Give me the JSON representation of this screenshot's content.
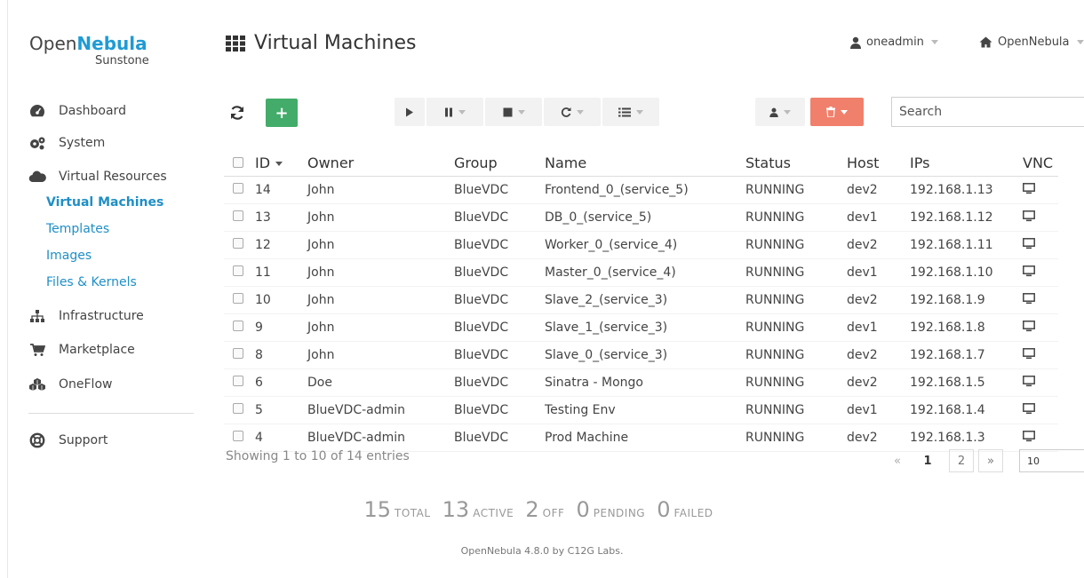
{
  "logo": {
    "prefix": "Open",
    "brand": "Nebula",
    "sub": "Sunstone"
  },
  "sidebar": {
    "items": [
      {
        "label": "Dashboard",
        "icon": "dashboard-icon"
      },
      {
        "label": "System",
        "icon": "cogs-icon"
      },
      {
        "label": "Virtual Resources",
        "icon": "cloud-icon"
      },
      {
        "label": "Infrastructure",
        "icon": "sitemap-icon"
      },
      {
        "label": "Marketplace",
        "icon": "cart-icon"
      },
      {
        "label": "OneFlow",
        "icon": "cubes-icon"
      },
      {
        "label": "Support",
        "icon": "lifebuoy-icon"
      }
    ],
    "subitems": [
      {
        "label": "Virtual Machines",
        "active": true
      },
      {
        "label": "Templates"
      },
      {
        "label": "Images"
      },
      {
        "label": "Files & Kernels"
      }
    ]
  },
  "header": {
    "title": "Virtual Machines",
    "user": "oneadmin",
    "zone": "OpenNebula"
  },
  "toolbar": {
    "add_label": "+",
    "search_placeholder": "Search"
  },
  "table": {
    "columns": [
      "ID",
      "Owner",
      "Group",
      "Name",
      "Status",
      "Host",
      "IPs",
      "VNC"
    ],
    "rows": [
      [
        "14",
        "John",
        "BlueVDC",
        "Frontend_0_(service_5)",
        "RUNNING",
        "dev2",
        "192.168.1.13"
      ],
      [
        "13",
        "John",
        "BlueVDC",
        "DB_0_(service_5)",
        "RUNNING",
        "dev1",
        "192.168.1.12"
      ],
      [
        "12",
        "John",
        "BlueVDC",
        "Worker_0_(service_4)",
        "RUNNING",
        "dev2",
        "192.168.1.11"
      ],
      [
        "11",
        "John",
        "BlueVDC",
        "Master_0_(service_4)",
        "RUNNING",
        "dev1",
        "192.168.1.10"
      ],
      [
        "10",
        "John",
        "BlueVDC",
        "Slave_2_(service_3)",
        "RUNNING",
        "dev2",
        "192.168.1.9"
      ],
      [
        "9",
        "John",
        "BlueVDC",
        "Slave_1_(service_3)",
        "RUNNING",
        "dev1",
        "192.168.1.8"
      ],
      [
        "8",
        "John",
        "BlueVDC",
        "Slave_0_(service_3)",
        "RUNNING",
        "dev2",
        "192.168.1.7"
      ],
      [
        "6",
        "Doe",
        "BlueVDC",
        "Sinatra - Mongo",
        "RUNNING",
        "dev2",
        "192.168.1.5"
      ],
      [
        "5",
        "BlueVDC-admin",
        "BlueVDC",
        "Testing Env",
        "RUNNING",
        "dev1",
        "192.168.1.4"
      ],
      [
        "4",
        "BlueVDC-admin",
        "BlueVDC",
        "Prod Machine",
        "RUNNING",
        "dev2",
        "192.168.1.3"
      ]
    ]
  },
  "pagination": {
    "showing": "Showing 1 to 10 of 14 entries",
    "prev": "«",
    "pages": [
      "1",
      "2"
    ],
    "next": "»",
    "page_size": "10"
  },
  "summary": {
    "total": "15",
    "total_label": "TOTAL",
    "active": "13",
    "active_label": "ACTIVE",
    "off": "2",
    "off_label": "OFF",
    "pending": "0",
    "pending_label": "PENDING",
    "failed": "0",
    "failed_label": "FAILED"
  },
  "footer": "OpenNebula 4.8.0 by C12G Labs.",
  "colors": {
    "accent": "#1f8fc6",
    "green": "#43ac6a",
    "red": "#f0806c"
  }
}
